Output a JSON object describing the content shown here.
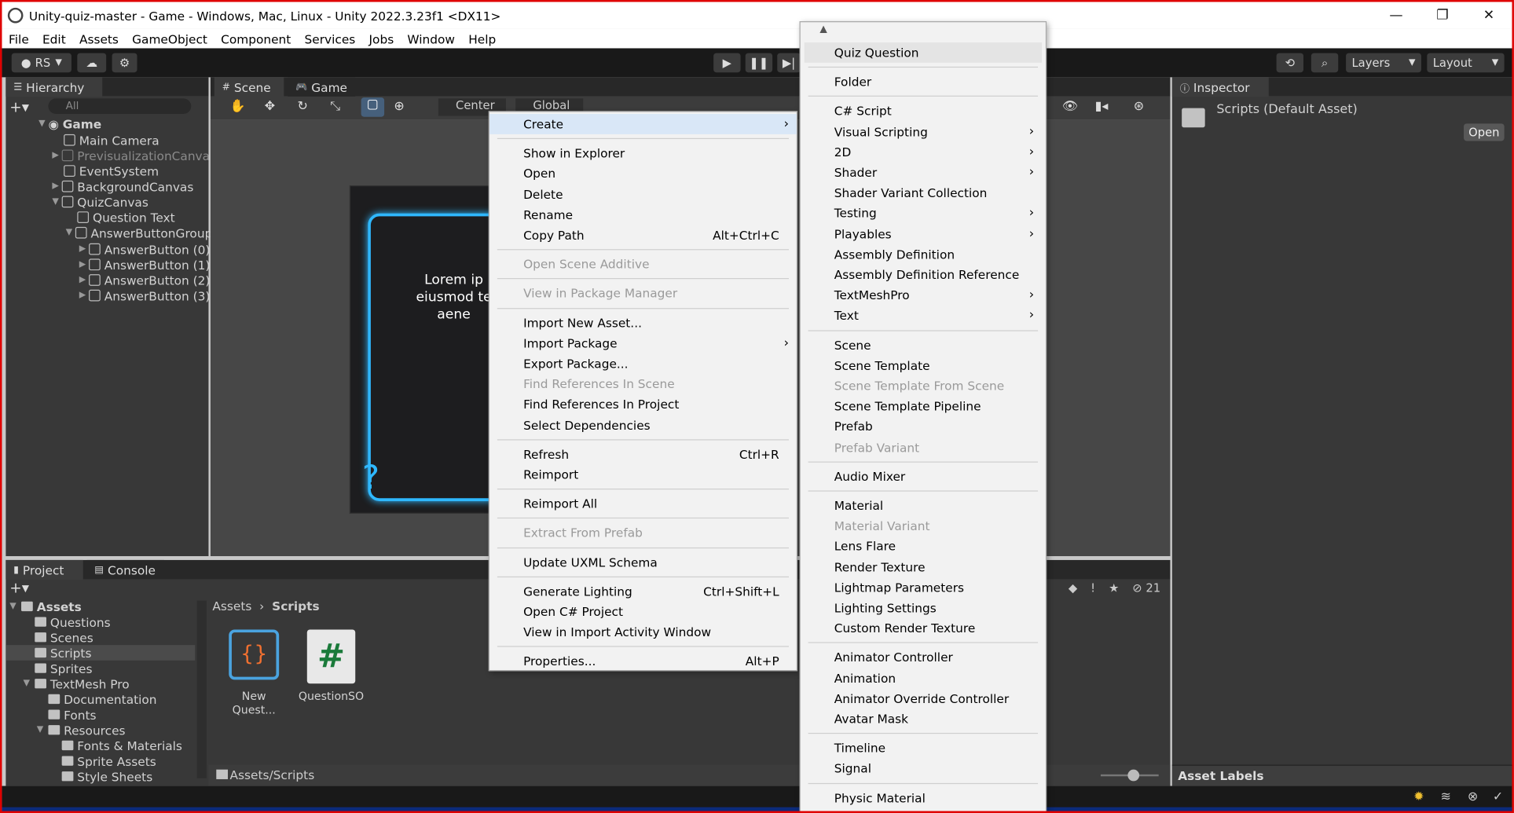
{
  "window": {
    "title": "Unity-quiz-master - Game - Windows, Mac, Linux - Unity 2022.3.23f1 <DX11>",
    "controls": [
      "—",
      "❐",
      "✕"
    ]
  },
  "menubar": [
    "File",
    "Edit",
    "Assets",
    "GameObject",
    "Component",
    "Services",
    "Jobs",
    "Window",
    "Help"
  ],
  "toolbar": {
    "account": "RS",
    "layers": "Layers",
    "layout": "Layout"
  },
  "hierarchy": {
    "tab": "Hierarchy",
    "search_placeholder": "All",
    "items": [
      {
        "label": "Game",
        "depth": 0
      },
      {
        "label": "Main Camera",
        "depth": 1
      },
      {
        "label": "PrevisualizationCanva",
        "depth": 1
      },
      {
        "label": "EventSystem",
        "depth": 1
      },
      {
        "label": "BackgroundCanvas",
        "depth": 1
      },
      {
        "label": "QuizCanvas",
        "depth": 1
      },
      {
        "label": "Question Text",
        "depth": 2
      },
      {
        "label": "AnswerButtonGroup",
        "depth": 2
      },
      {
        "label": "AnswerButton (0)",
        "depth": 3
      },
      {
        "label": "AnswerButton (1)",
        "depth": 3
      },
      {
        "label": "AnswerButton (2)",
        "depth": 3
      },
      {
        "label": "AnswerButton (3)",
        "depth": 3
      }
    ]
  },
  "scene": {
    "tabs": [
      "Scene",
      "Game"
    ],
    "pivot": "Center",
    "space": "Global",
    "preview_text_1": "Lorem ip",
    "preview_text_2": "eiusmod te",
    "preview_text_3": "aene"
  },
  "inspector": {
    "tab": "Inspector",
    "asset_title": "Scripts (Default Asset)",
    "open_button": "Open",
    "asset_labels": "Asset Labels"
  },
  "project": {
    "tabs": [
      "Project",
      "Console"
    ],
    "hidden_count": "21",
    "breadcrumb_root": "Assets",
    "breadcrumb_current": "Scripts",
    "footer_path": "Assets/Scripts",
    "tree": [
      {
        "label": "Assets",
        "depth": 0
      },
      {
        "label": "Questions",
        "depth": 1
      },
      {
        "label": "Scenes",
        "depth": 1
      },
      {
        "label": "Scripts",
        "depth": 1
      },
      {
        "label": "Sprites",
        "depth": 1
      },
      {
        "label": "TextMesh Pro",
        "depth": 1
      },
      {
        "label": "Documentation",
        "depth": 2
      },
      {
        "label": "Fonts",
        "depth": 2
      },
      {
        "label": "Resources",
        "depth": 2
      },
      {
        "label": "Fonts & Materials",
        "depth": 3
      },
      {
        "label": "Sprite Assets",
        "depth": 3
      },
      {
        "label": "Style Sheets",
        "depth": 3
      }
    ],
    "files": [
      {
        "label": "New Quest..."
      },
      {
        "label": "QuestionSO"
      }
    ]
  },
  "context_menu": [
    {
      "label": "Create",
      "submenu": true,
      "highlight": true
    },
    {
      "sep": true
    },
    {
      "label": "Show in Explorer"
    },
    {
      "label": "Open"
    },
    {
      "label": "Delete"
    },
    {
      "label": "Rename"
    },
    {
      "label": "Copy Path",
      "shortcut": "Alt+Ctrl+C"
    },
    {
      "sep": true
    },
    {
      "label": "Open Scene Additive",
      "disabled": true
    },
    {
      "sep": true
    },
    {
      "label": "View in Package Manager",
      "disabled": true
    },
    {
      "sep": true
    },
    {
      "label": "Import New Asset..."
    },
    {
      "label": "Import Package",
      "submenu": true
    },
    {
      "label": "Export Package..."
    },
    {
      "label": "Find References In Scene",
      "disabled": true
    },
    {
      "label": "Find References In Project"
    },
    {
      "label": "Select Dependencies"
    },
    {
      "sep": true
    },
    {
      "label": "Refresh",
      "shortcut": "Ctrl+R"
    },
    {
      "label": "Reimport"
    },
    {
      "sep": true
    },
    {
      "label": "Reimport All"
    },
    {
      "sep": true
    },
    {
      "label": "Extract From Prefab",
      "disabled": true
    },
    {
      "sep": true
    },
    {
      "label": "Update UXML Schema"
    },
    {
      "sep": true
    },
    {
      "label": "Generate Lighting",
      "shortcut": "Ctrl+Shift+L"
    },
    {
      "label": "Open C# Project"
    },
    {
      "label": "View in Import Activity Window"
    },
    {
      "sep": true
    },
    {
      "label": "Properties...",
      "shortcut": "Alt+P"
    }
  ],
  "create_submenu": [
    {
      "label": "Quiz Question",
      "highlight": true
    },
    {
      "sep": true
    },
    {
      "label": "Folder"
    },
    {
      "sep": true
    },
    {
      "label": "C# Script"
    },
    {
      "label": "Visual Scripting",
      "submenu": true
    },
    {
      "label": "2D",
      "submenu": true
    },
    {
      "label": "Shader",
      "submenu": true
    },
    {
      "label": "Shader Variant Collection"
    },
    {
      "label": "Testing",
      "submenu": true
    },
    {
      "label": "Playables",
      "submenu": true
    },
    {
      "label": "Assembly Definition"
    },
    {
      "label": "Assembly Definition Reference"
    },
    {
      "label": "TextMeshPro",
      "submenu": true
    },
    {
      "label": "Text",
      "submenu": true
    },
    {
      "sep": true
    },
    {
      "label": "Scene"
    },
    {
      "label": "Scene Template"
    },
    {
      "label": "Scene Template From Scene",
      "disabled": true
    },
    {
      "label": "Scene Template Pipeline"
    },
    {
      "label": "Prefab"
    },
    {
      "label": "Prefab Variant",
      "disabled": true
    },
    {
      "sep": true
    },
    {
      "label": "Audio Mixer"
    },
    {
      "sep": true
    },
    {
      "label": "Material"
    },
    {
      "label": "Material Variant",
      "disabled": true
    },
    {
      "label": "Lens Flare"
    },
    {
      "label": "Render Texture"
    },
    {
      "label": "Lightmap Parameters"
    },
    {
      "label": "Lighting Settings"
    },
    {
      "label": "Custom Render Texture"
    },
    {
      "sep": true
    },
    {
      "label": "Animator Controller"
    },
    {
      "label": "Animation"
    },
    {
      "label": "Animator Override Controller"
    },
    {
      "label": "Avatar Mask"
    },
    {
      "sep": true
    },
    {
      "label": "Timeline"
    },
    {
      "label": "Signal"
    },
    {
      "sep": true
    },
    {
      "label": "Physic Material"
    }
  ],
  "colors": {
    "editor_dark": "#191919",
    "panel": "#383838",
    "menu_bg": "#f2f2f2",
    "highlight": "#d9e7f7",
    "neon": "#2fb8ff",
    "frame_border": "#e00000"
  }
}
